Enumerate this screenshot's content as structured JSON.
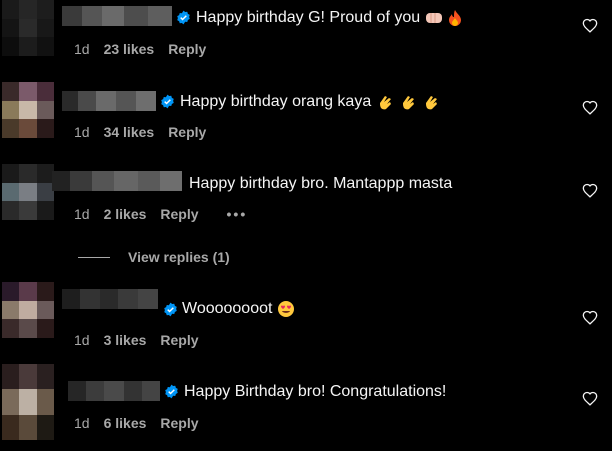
{
  "comments": [
    {
      "text": "Happy birthday G! Proud of you",
      "age": "1d",
      "likes": "23 likes",
      "reply": "Reply",
      "emojis": [
        "fist-bump",
        "fire"
      ]
    },
    {
      "text": "Happy birthday orang kaya",
      "age": "1d",
      "likes": "34 likes",
      "reply": "Reply",
      "emojis": [
        "clap",
        "clap",
        "clap"
      ]
    },
    {
      "text": "Happy birthday bro. Mantappp masta",
      "age": "1d",
      "likes": "2 likes",
      "reply": "Reply",
      "more": "•••"
    },
    {
      "text": "Woooooooot",
      "age": "1d",
      "likes": "3 likes",
      "reply": "Reply",
      "emojis": [
        "heart-eyes"
      ]
    },
    {
      "text": "Happy Birthday bro! Congratulations!",
      "age": "1d",
      "likes": "6 likes",
      "reply": "Reply"
    }
  ],
  "view_replies": "View replies (1)",
  "colors": {
    "background": "#000000",
    "text": "#f5f5f5",
    "muted": "#a8a8a8",
    "verified": "#0095f6"
  },
  "icons": [
    "verified-badge-icon",
    "heart-outline-icon",
    "more-options-icon"
  ]
}
